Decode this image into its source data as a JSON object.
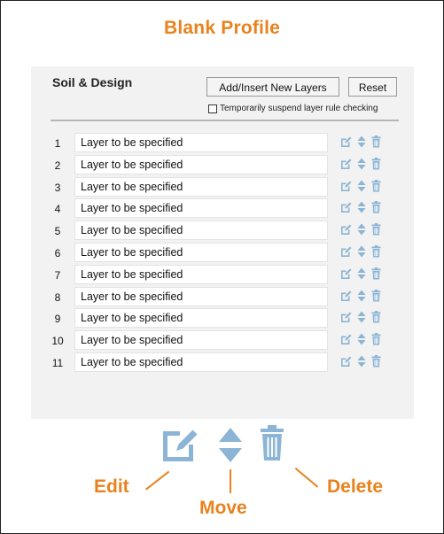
{
  "title": "Blank Profile",
  "panel": {
    "title": "Soil & Design",
    "add_button": "Add/Insert New Layers",
    "reset_button": "Reset",
    "suspend_checkbox": {
      "label": "Temporarily suspend layer rule checking",
      "checked": false
    }
  },
  "layers": [
    {
      "num": "1",
      "name": "Layer to be specified"
    },
    {
      "num": "2",
      "name": "Layer to be specified"
    },
    {
      "num": "3",
      "name": "Layer to be specified"
    },
    {
      "num": "4",
      "name": "Layer to be specified"
    },
    {
      "num": "5",
      "name": "Layer to be specified"
    },
    {
      "num": "6",
      "name": "Layer to be specified"
    },
    {
      "num": "7",
      "name": "Layer to be specified"
    },
    {
      "num": "8",
      "name": "Layer to be specified"
    },
    {
      "num": "9",
      "name": "Layer to be specified"
    },
    {
      "num": "10",
      "name": "Layer to be specified"
    },
    {
      "num": "11",
      "name": "Layer to be specified"
    }
  ],
  "legend": {
    "edit": "Edit",
    "move": "Move",
    "delete": "Delete"
  },
  "colors": {
    "accent": "#e8821e",
    "icon": "#8cb4d4"
  },
  "icons": [
    "edit-icon",
    "move-icon",
    "delete-icon"
  ]
}
